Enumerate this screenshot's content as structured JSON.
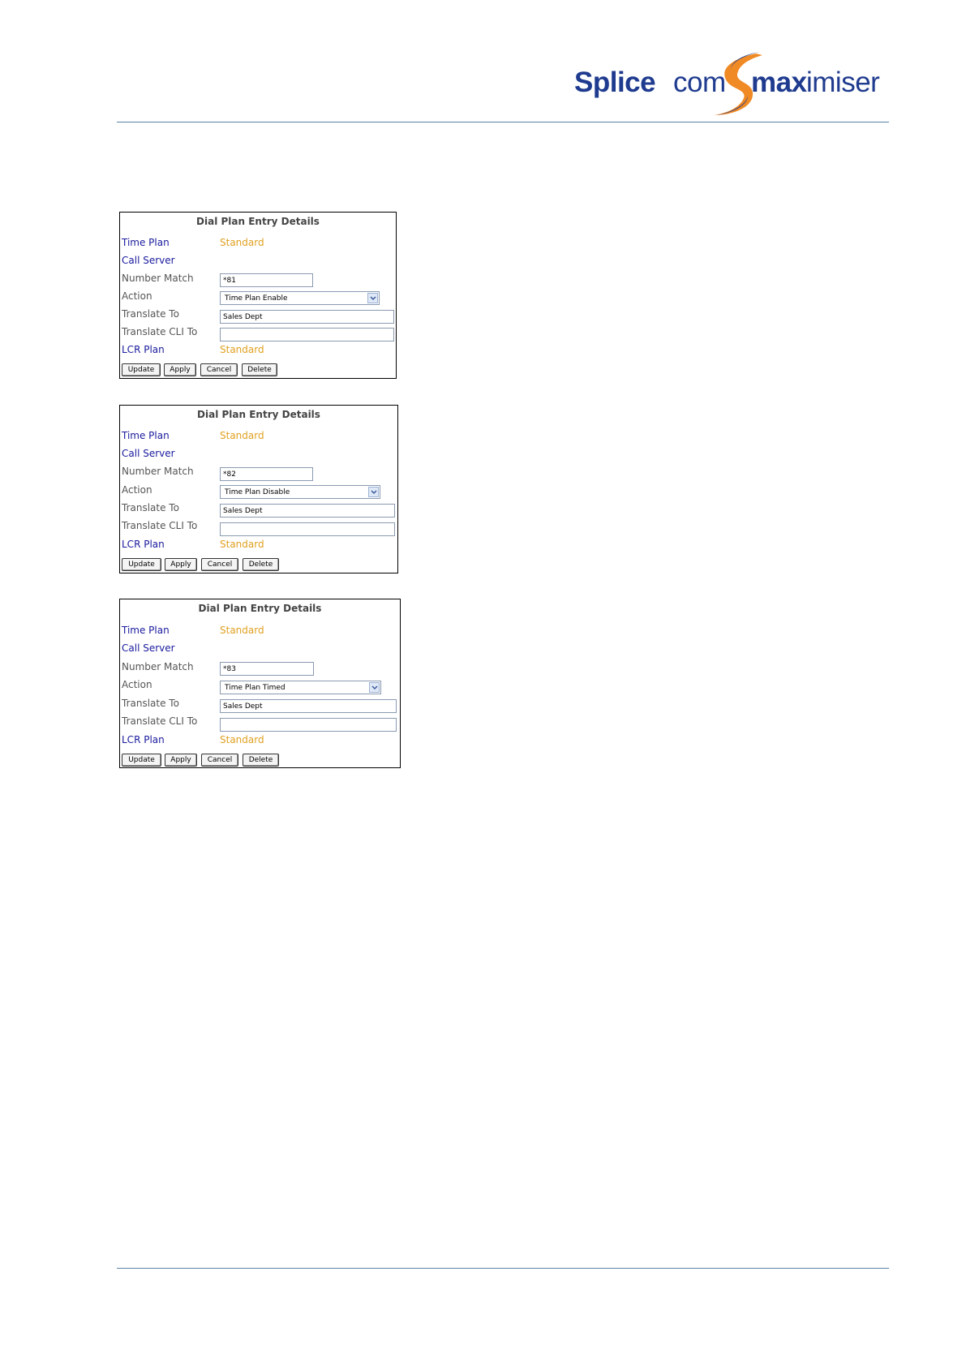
{
  "brand": {
    "splice": "Splice",
    "com": "com",
    "max": "max",
    "imiser": "imiser",
    "color_primary": "#1f3b8f",
    "color_swoosh": "#f08a24"
  },
  "labels": {
    "panel_title": "Dial Plan Entry Details",
    "time_plan": "Time Plan",
    "call_server": "Call Server",
    "number_match": "Number Match",
    "action": "Action",
    "translate_to": "Translate To",
    "translate_cli_to": "Translate CLI To",
    "lcr_plan": "LCR Plan"
  },
  "buttons": {
    "update": "Update",
    "apply": "Apply",
    "cancel": "Cancel",
    "delete": "Delete"
  },
  "panels": [
    {
      "time_plan_value": "Standard",
      "number_match_value": "*81",
      "action_value": "Time Plan Enable",
      "translate_to_value": "Sales Dept",
      "translate_cli_to_value": "",
      "lcr_plan_value": "Standard"
    },
    {
      "time_plan_value": "Standard",
      "number_match_value": "*82",
      "action_value": "Time Plan Disable",
      "translate_to_value": "Sales Dept",
      "translate_cli_to_value": "",
      "lcr_plan_value": "Standard"
    },
    {
      "time_plan_value": "Standard",
      "number_match_value": "*83",
      "action_value": "Time Plan Timed",
      "translate_to_value": "Sales Dept",
      "translate_cli_to_value": "",
      "lcr_plan_value": "Standard"
    }
  ],
  "colors": {
    "link_label": "#1a1a9e",
    "plain_label": "#555555",
    "value_orange": "#e0a020",
    "rule": "#5a7fa6"
  }
}
